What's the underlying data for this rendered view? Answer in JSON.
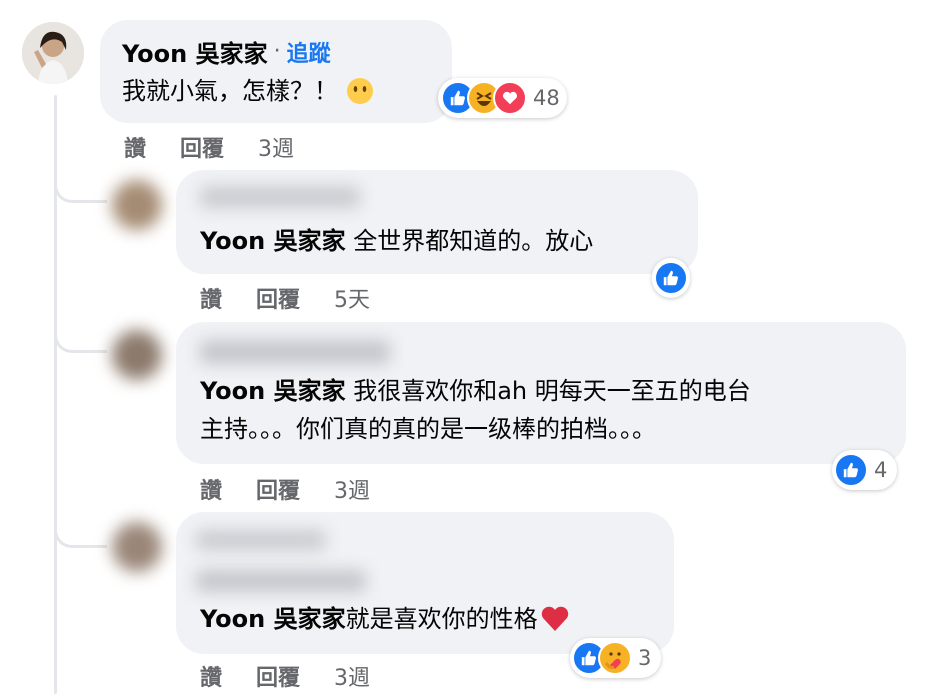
{
  "main_comment": {
    "author": "Yoon 吳家家",
    "separator": "·",
    "follow_label": "追蹤",
    "text": "我就小氣，怎樣？！",
    "reaction_count": "48",
    "actions": {
      "like": "讚",
      "reply": "回覆",
      "time": "3週"
    }
  },
  "replies": [
    {
      "mention": "Yoon 吳家家",
      "text": " 全世界都知道的。放心",
      "reaction_count": "",
      "actions": {
        "like": "讚",
        "reply": "回覆",
        "time": "5天"
      }
    },
    {
      "mention": "Yoon 吳家家",
      "text_line1": " 我很喜欢你和ah 明每天一至五的电台",
      "text_line2": "主持。。。你们真的真的是一级棒的拍档。。。",
      "reaction_count": "4",
      "actions": {
        "like": "讚",
        "reply": "回覆",
        "time": "3週"
      }
    },
    {
      "mention": "Yoon 吳家家",
      "text": " 就是喜欢你的性格",
      "reaction_count": "3",
      "actions": {
        "like": "讚",
        "reply": "回覆",
        "time": "3週"
      }
    }
  ],
  "colors": {
    "like_blue": "#1877f2",
    "love_red": "#f33e58",
    "haha_yellow": "#f7b125",
    "link_blue": "#385898"
  }
}
